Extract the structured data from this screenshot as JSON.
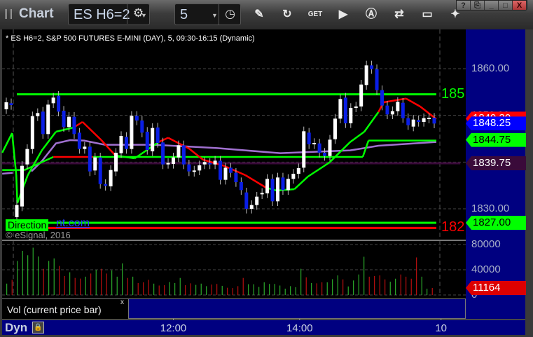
{
  "app_title": "Chart",
  "toolbar": {
    "symbol": "ES H6=2",
    "interval": "5",
    "tools": [
      {
        "name": "pencil-icon",
        "glyph": "✎"
      },
      {
        "name": "chart-refresh-icon",
        "glyph": "↻"
      },
      {
        "name": "get-icon",
        "glyph": "GET"
      },
      {
        "name": "play-icon",
        "glyph": "▶"
      },
      {
        "name": "auto-icon",
        "glyph": "Ⓐ"
      },
      {
        "name": "link-icon",
        "glyph": "⇄"
      },
      {
        "name": "comment-icon",
        "glyph": "▭"
      },
      {
        "name": "bird-icon",
        "glyph": "✦"
      }
    ],
    "window_buttons": [
      "?",
      "⎘",
      "_",
      "□",
      "X"
    ]
  },
  "info_line": "* ES H6=2, S&P 500 FUTURES E-MINI (DAY), 5, 09:30-16:15 (Dynamic)",
  "price_axis": {
    "labels": [
      {
        "text": "1860.00",
        "price": 1860
      },
      {
        "text": "1850.00",
        "price": 1850
      },
      {
        "text": "1830.00",
        "price": 1830
      }
    ],
    "tags": [
      {
        "text": "1849.30",
        "price": 1849.3,
        "bg": "#ff0000",
        "fg": "#fff"
      },
      {
        "text": "1848.25",
        "price": 1848.25,
        "bg": "#0000ff",
        "fg": "#fff"
      },
      {
        "text": "1844.75",
        "price": 1844.75,
        "bg": "#00ff00",
        "fg": "#000"
      },
      {
        "text": "1839.75",
        "price": 1839.75,
        "bg": "#3a0a3a",
        "fg": "#fff"
      },
      {
        "text": "1827.00",
        "price": 1827.0,
        "bg": "#00ff00",
        "fg": "#000"
      }
    ]
  },
  "levels": [
    {
      "price": 1854.5,
      "color": "#00ff00",
      "label": "185",
      "from": 0,
      "to": 80.4
    },
    {
      "price": 1827.0,
      "color": "#00ff00",
      "label": "",
      "from": -2,
      "to": 80.4
    },
    {
      "price": 1825.9,
      "color": "#ff0000",
      "label": "182",
      "from": -2,
      "to": 80.4
    },
    {
      "price": 1839.75,
      "color": "#3a0a3a",
      "label": "",
      "from": -3,
      "to": 85
    }
  ],
  "direction_label": "Direction",
  "direction_link": "nt.com",
  "copyright": "© eSignal, 2016",
  "colors": {
    "up": "#ffffff",
    "down": "#0a1ee6",
    "ma_up": "#00ff00",
    "ma_down": "#ff0000",
    "slow": "#a070d0",
    "vol_up": "#33cc33",
    "vol_down": "#dd1111"
  },
  "candles_prev_day": [
    [
      1851.3,
      1852.8
    ],
    [
      1852.6,
      1852.2
    ]
  ],
  "candles": [
    [
      1828.2,
      1830.8
    ],
    [
      1830.5,
      1839.2
    ],
    [
      1839.5,
      1842.8
    ],
    [
      1842.8,
      1849.8
    ],
    [
      1849.8,
      1850.5
    ],
    [
      1850.8,
      1846
    ],
    [
      1846,
      1852.3
    ],
    [
      1852.6,
      1853.8
    ],
    [
      1854.2,
      1850.8
    ],
    [
      1851,
      1847.5
    ],
    [
      1847.5,
      1849.7
    ],
    [
      1849.7,
      1846
    ],
    [
      1846.3,
      1842.8
    ],
    [
      1842.8,
      1843.3
    ],
    [
      1843.3,
      1838
    ],
    [
      1838.2,
      1841
    ],
    [
      1841,
      1835.3
    ],
    [
      1835.3,
      1834.9
    ],
    [
      1834.8,
      1838.3
    ],
    [
      1838,
      1842
    ],
    [
      1841.9,
      1845.6
    ],
    [
      1845.4,
      1842.8
    ],
    [
      1842.8,
      1849.9
    ],
    [
      1849.9,
      1848.9
    ],
    [
      1848.9,
      1846.3
    ],
    [
      1846.5,
      1842.6
    ],
    [
      1842.3,
      1847.3
    ],
    [
      1847.4,
      1844.1
    ],
    [
      1844.2,
      1839.5
    ],
    [
      1839.6,
      1839.8
    ],
    [
      1839.6,
      1841
    ],
    [
      1841,
      1843.6
    ],
    [
      1843.6,
      1839.5
    ],
    [
      1839.5,
      1838
    ],
    [
      1837.9,
      1838.2
    ],
    [
      1838.2,
      1839.3
    ],
    [
      1839.5,
      1840
    ],
    [
      1839.8,
      1839.5
    ],
    [
      1839.5,
      1840.3
    ],
    [
      1840.3,
      1836.2
    ],
    [
      1836.2,
      1838.8
    ],
    [
      1838.8,
      1837.7
    ],
    [
      1837.7,
      1835.7
    ],
    [
      1835.7,
      1834
    ],
    [
      1833.5,
      1830
    ],
    [
      1830,
      1830.8
    ],
    [
      1830.8,
      1832.6
    ],
    [
      1833.1,
      1833.4
    ],
    [
      1833.3,
      1836.4
    ],
    [
      1836.4,
      1831.6
    ],
    [
      1831.6,
      1836.7
    ],
    [
      1836.7,
      1834
    ],
    [
      1834,
      1836.4
    ],
    [
      1836.4,
      1837.5
    ],
    [
      1837.5,
      1838.7
    ],
    [
      1838.8,
      1846.6
    ],
    [
      1846.3,
      1843.8
    ],
    [
      1843.8,
      1844.1
    ],
    [
      1844,
      1842
    ],
    [
      1842,
      1841.3
    ],
    [
      1841.3,
      1844.8
    ],
    [
      1844.9,
      1849.3
    ],
    [
      1849.3,
      1853.5
    ],
    [
      1853.8,
      1848.3
    ],
    [
      1848.3,
      1851.6
    ],
    [
      1851.7,
      1851.9
    ],
    [
      1851.9,
      1856.6
    ],
    [
      1856.5,
      1860.7
    ],
    [
      1860.7,
      1859.9
    ],
    [
      1859.9,
      1855.4
    ],
    [
      1855.4,
      1852.1
    ],
    [
      1852.1,
      1850.2
    ],
    [
      1850.2,
      1850.9
    ],
    [
      1850.9,
      1852.9
    ],
    [
      1852.7,
      1849.4
    ],
    [
      1849.4,
      1847.9
    ],
    [
      1847.6,
      1849.1
    ],
    [
      1849,
      1848.6
    ],
    [
      1848.6,
      1849.4
    ],
    [
      1849.3,
      1849.5
    ],
    [
      1849.5,
      1848.25
    ]
  ],
  "fast_ma": [
    [
      -2.8,
      1842.0,
      "u"
    ],
    [
      -0.9,
      1846.2,
      "u"
    ],
    [
      -0.1,
      1837.2,
      "u"
    ],
    [
      0.1,
      1831.2,
      "u"
    ],
    [
      2.1,
      1837.2,
      "u"
    ],
    [
      4.8,
      1842.5,
      "u"
    ],
    [
      7.5,
      1846.5,
      "u"
    ],
    [
      10.9,
      1847.4,
      "u"
    ],
    [
      12.6,
      1848.6,
      "d"
    ],
    [
      16.2,
      1844.7,
      "d"
    ],
    [
      18.9,
      1841.4,
      "d"
    ],
    [
      22.6,
      1840.8,
      "u"
    ],
    [
      27.2,
      1844.3,
      "u"
    ],
    [
      29,
      1845.2,
      "d"
    ],
    [
      33,
      1842.9,
      "d"
    ],
    [
      35.7,
      1840.5,
      "d"
    ],
    [
      39.7,
      1839.2,
      "d"
    ],
    [
      43.8,
      1837.2,
      "d"
    ],
    [
      47.8,
      1834.5,
      "d"
    ],
    [
      49.8,
      1833.9,
      "u"
    ],
    [
      53.2,
      1834.2,
      "u"
    ],
    [
      55.8,
      1836.9,
      "u"
    ],
    [
      59.9,
      1839.9,
      "u"
    ],
    [
      63.9,
      1844.3,
      "u"
    ],
    [
      66.6,
      1846.5,
      "u"
    ],
    [
      69.3,
      1850.7,
      "u"
    ],
    [
      70.3,
      1852.8,
      "d"
    ],
    [
      74.6,
      1853.6,
      "d"
    ],
    [
      77.3,
      1851.9,
      "d"
    ],
    [
      80.4,
      1849.2,
      "d"
    ]
  ],
  "slow_ma": [
    [
      2.8,
      1838
    ],
    [
      4.8,
      1840.2
    ],
    [
      7.5,
      1844
    ],
    [
      10.2,
      1844.7
    ],
    [
      12.9,
      1844.6
    ],
    [
      16.9,
      1843.7
    ],
    [
      26.3,
      1843.7
    ],
    [
      38.4,
      1843
    ],
    [
      50.5,
      1841.9
    ],
    [
      57.2,
      1842.2
    ],
    [
      63.9,
      1842.5
    ],
    [
      69.3,
      1843.5
    ],
    [
      80.4,
      1844.3
    ]
  ],
  "slow_ma_prev": [
    [
      -2.8,
      1837.5
    ],
    [
      -0.8,
      1837.7
    ]
  ],
  "step_line": [
    [
      -2.8,
      1838.3,
      "u"
    ],
    [
      -0.8,
      1838.3,
      "u"
    ],
    [
      1.5,
      1838.3,
      "u"
    ],
    [
      7,
      1841.1,
      "u"
    ],
    [
      14.6,
      1841.1,
      "d"
    ],
    [
      55.4,
      1841.1,
      "u"
    ],
    [
      66.3,
      1841.1,
      "u"
    ],
    [
      67.4,
      1844.6,
      "u"
    ],
    [
      80.4,
      1844.6,
      "u"
    ]
  ],
  "volume": {
    "axis_labels": [
      {
        "text": "80000",
        "v": 80000
      },
      {
        "text": "40000",
        "v": 40000
      },
      {
        "text": "0",
        "v": 0
      }
    ],
    "current_tag": "11164",
    "bars": [
      [
        18000,
        "u"
      ],
      [
        24000,
        "d"
      ],
      [
        54000,
        "u"
      ],
      [
        70000,
        "u"
      ],
      [
        63000,
        "u"
      ],
      [
        75000,
        "u"
      ],
      [
        61000,
        "u"
      ],
      [
        41500,
        "d"
      ],
      [
        54000,
        "u"
      ],
      [
        58000,
        "u"
      ],
      [
        46000,
        "d"
      ],
      [
        30000,
        "d"
      ],
      [
        36000,
        "u"
      ],
      [
        27000,
        "d"
      ],
      [
        26000,
        "d"
      ],
      [
        29000,
        "u"
      ],
      [
        34000,
        "d"
      ],
      [
        40000,
        "u"
      ],
      [
        41500,
        "d"
      ],
      [
        34000,
        "d"
      ],
      [
        39000,
        "u"
      ],
      [
        29000,
        "u"
      ],
      [
        50000,
        "u"
      ],
      [
        27000,
        "d"
      ],
      [
        29000,
        "u"
      ],
      [
        19000,
        "d"
      ],
      [
        20000,
        "d"
      ],
      [
        24000,
        "d"
      ],
      [
        18000,
        "u"
      ],
      [
        15000,
        "d"
      ],
      [
        15500,
        "d"
      ],
      [
        20500,
        "u"
      ],
      [
        19000,
        "u"
      ],
      [
        27000,
        "u"
      ],
      [
        15500,
        "d"
      ],
      [
        18500,
        "d"
      ],
      [
        16000,
        "u"
      ],
      [
        18000,
        "u"
      ],
      [
        14000,
        "u"
      ],
      [
        16500,
        "d"
      ],
      [
        17500,
        "d"
      ],
      [
        14500,
        "u"
      ],
      [
        11500,
        "d"
      ],
      [
        11000,
        "d"
      ],
      [
        14000,
        "d"
      ],
      [
        27000,
        "d"
      ],
      [
        17000,
        "u"
      ],
      [
        17000,
        "u"
      ],
      [
        12700,
        "u"
      ],
      [
        20000,
        "u"
      ],
      [
        17500,
        "u"
      ],
      [
        17500,
        "u"
      ],
      [
        15000,
        "u"
      ],
      [
        10000,
        "u"
      ],
      [
        14000,
        "u"
      ],
      [
        12300,
        "u"
      ],
      [
        41500,
        "u"
      ],
      [
        28000,
        "d"
      ],
      [
        19000,
        "u"
      ],
      [
        18500,
        "d"
      ],
      [
        20000,
        "d"
      ],
      [
        20000,
        "u"
      ],
      [
        25000,
        "u"
      ],
      [
        31000,
        "u"
      ],
      [
        24700,
        "d"
      ],
      [
        13500,
        "u"
      ],
      [
        23000,
        "u"
      ],
      [
        32500,
        "u"
      ],
      [
        60600,
        "u"
      ],
      [
        29000,
        "d"
      ],
      [
        30000,
        "d"
      ],
      [
        31000,
        "d"
      ],
      [
        24700,
        "d"
      ],
      [
        21000,
        "u"
      ],
      [
        25800,
        "u"
      ],
      [
        32500,
        "d"
      ],
      [
        29000,
        "d"
      ],
      [
        25800,
        "d"
      ],
      [
        59500,
        "d"
      ],
      [
        29000,
        "u"
      ],
      [
        10000,
        "u"
      ],
      [
        11164,
        "d"
      ]
    ]
  },
  "study_label": "Vol (current price bar)",
  "study_close": "x",
  "time_axis": {
    "mode": "Dyn",
    "labels": [
      {
        "text": "12:00",
        "bar": 30
      },
      {
        "text": "14:00",
        "bar": 54.2
      },
      {
        "text": "10",
        "bar": 81.3
      }
    ]
  }
}
